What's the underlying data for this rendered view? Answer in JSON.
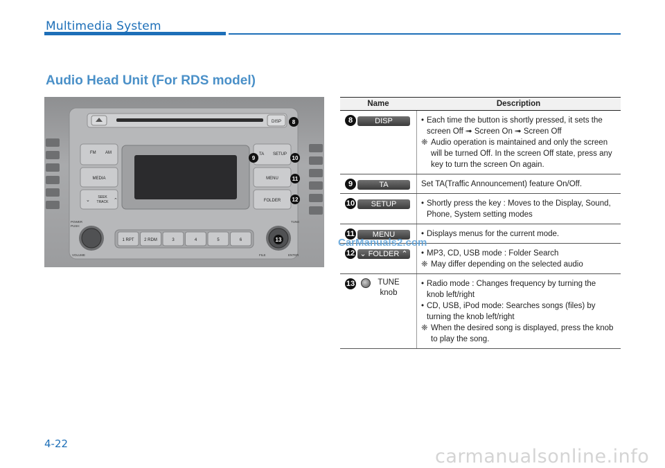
{
  "header": {
    "title": "Multimedia System",
    "accent_color": "#1d6fb8"
  },
  "section_title": "Audio Head Unit (For RDS model)",
  "photo": {
    "buttons": {
      "fm": "FM",
      "am": "AM",
      "media": "MEDIA",
      "seek_line1": "SEEK",
      "seek_line2": "TRACK",
      "ta": "TA",
      "setup": "SETUP",
      "menu": "MENU",
      "folder": "FOLDER",
      "disp": "DISP",
      "presets": [
        "1 RPT",
        "2 RDM",
        "3",
        "4",
        "5",
        "6"
      ],
      "power_line1": "POWER",
      "power_line2": "PUSH",
      "volume": "VOLUME",
      "tune": "TUNE",
      "file": "FILE",
      "enter": "ENTER"
    },
    "callouts": [
      "8",
      "9",
      "10",
      "11",
      "12",
      "13"
    ]
  },
  "table": {
    "headers": {
      "name": "Name",
      "description": "Description"
    },
    "rows": [
      {
        "num": "8",
        "label": "DISP",
        "lines": [
          {
            "type": "bullet",
            "text": "Each time the button is shortly pressed, it sets the screen Off ➟ Screen On ➟ Screen Off"
          },
          {
            "type": "note",
            "mark": "❈",
            "text": "Audio operation is maintained and only the screen will be turned Off. In the screen Off state, press any key to turn the screen On again."
          }
        ]
      },
      {
        "num": "9",
        "label": "TA",
        "lines": [
          {
            "type": "plain",
            "text": "Set TA(Traffic Announcement) feature On/Off."
          }
        ]
      },
      {
        "num": "10",
        "label": "SETUP",
        "lines": [
          {
            "type": "bullet",
            "text": "Shortly press the key : Moves to the Display, Sound, Phone, System setting modes"
          }
        ]
      },
      {
        "num": "11",
        "label": "MENU",
        "lines": [
          {
            "type": "bullet",
            "text": "Displays menus for the current mode."
          }
        ]
      },
      {
        "num": "12",
        "label": "⌄ FOLDER ⌃",
        "lines": [
          {
            "type": "bullet",
            "text": "MP3, CD, USB mode : Folder Search"
          },
          {
            "type": "note",
            "mark": "❈",
            "text": "May differ depending on the selected audio"
          }
        ]
      },
      {
        "num": "13",
        "label": "TUNE knob",
        "knob": true,
        "lines": [
          {
            "type": "bullet",
            "text": "Radio mode : Changes frequency by turning the knob left/right"
          },
          {
            "type": "bullet",
            "text": "CD, USB, iPod mode: Searches songs (files) by turning the knob left/right"
          },
          {
            "type": "note",
            "mark": "❈",
            "text": "When the desired song is displayed, press the knob to play the song."
          }
        ]
      }
    ]
  },
  "watermark": "CarManuals2.com",
  "page_number": "4-22",
  "footer_watermark": "carmanualsonline.info"
}
